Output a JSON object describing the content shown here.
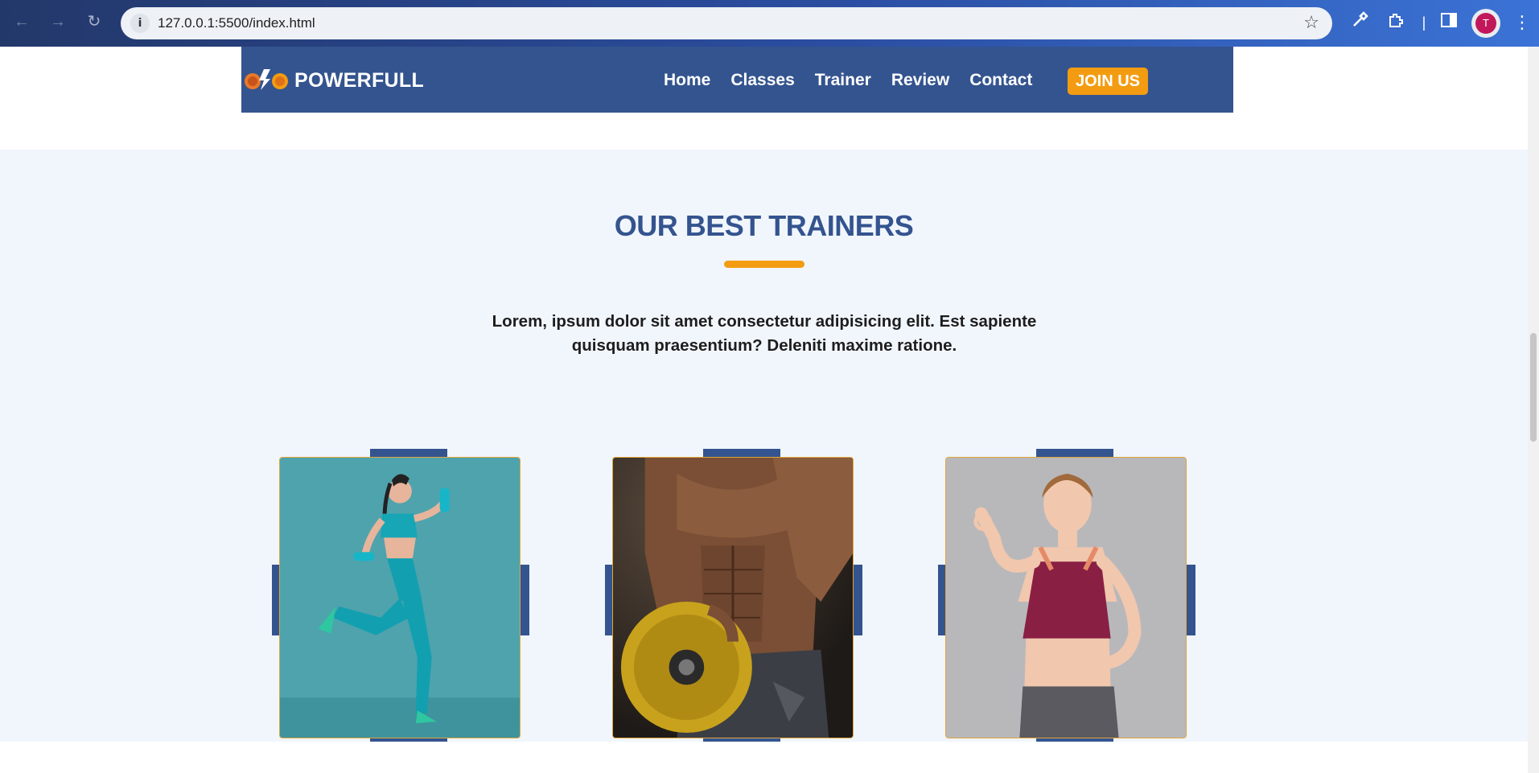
{
  "browser": {
    "url": "127.0.0.1:5500/index.html",
    "profile_initial": "T",
    "icons": [
      "back-icon",
      "forward-icon",
      "reload-icon",
      "site-info-icon",
      "star-icon",
      "eyedropper-icon",
      "extensions-icon",
      "side-panel-icon",
      "more-icon"
    ]
  },
  "header": {
    "brand": "POWERFULL",
    "menu": [
      "Home",
      "Classes",
      "Trainer",
      "Review",
      "Contact"
    ],
    "cta": "JOIN US"
  },
  "section": {
    "title": "OUR BEST TRAINERS",
    "description": "Lorem, ipsum dolor sit amet consectetur adipisicing elit. Est sapiente quisquam praesentium? Deleniti maxime ratione."
  },
  "trainers": [
    {
      "photo": "woman-running-with-dumbbells"
    },
    {
      "photo": "muscular-man-holding-weight-plate"
    },
    {
      "photo": "smiling-woman-ok-gesture"
    }
  ],
  "colors": {
    "brand_blue": "#34548f",
    "accent_orange": "#f39c12",
    "section_bg": "#f1f6fd"
  }
}
